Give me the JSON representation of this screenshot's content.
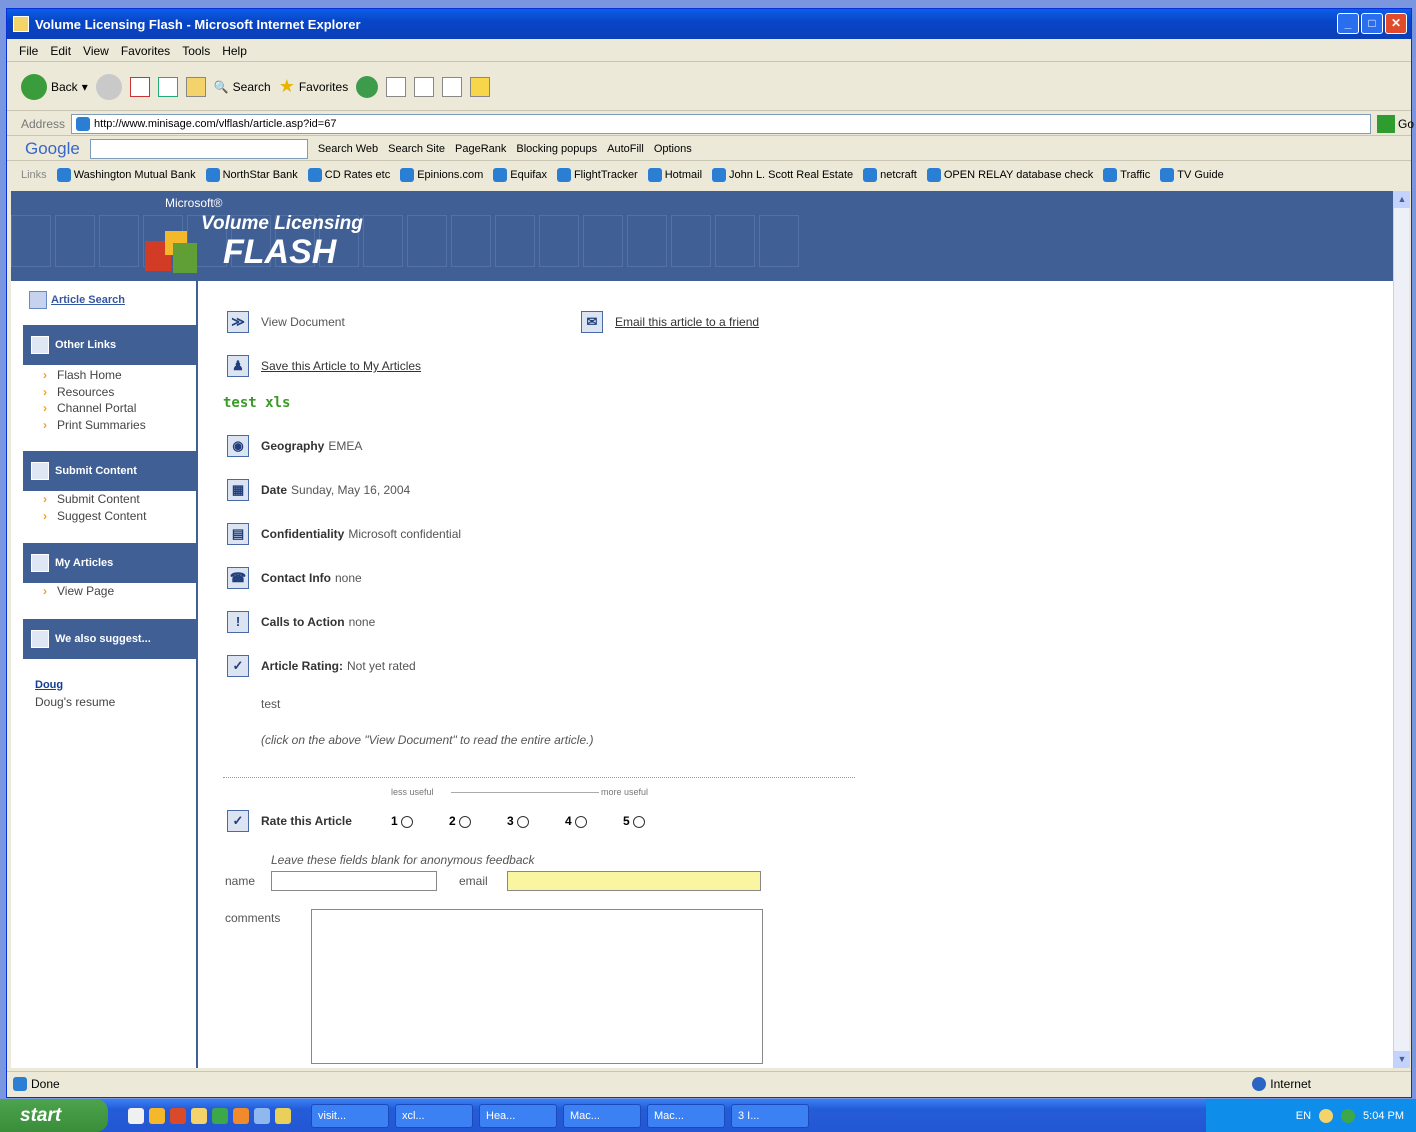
{
  "window": {
    "title": "Volume Licensing Flash - Microsoft Internet Explorer"
  },
  "menu": [
    "File",
    "Edit",
    "View",
    "Favorites",
    "Tools",
    "Help"
  ],
  "toolbar": {
    "back": "Back",
    "search": "Search",
    "favorites": "Favorites"
  },
  "address": {
    "label": "Address",
    "url": "http://www.minisage.com/vlflash/article.asp?id=67",
    "go": "Go"
  },
  "google": {
    "label": "Google",
    "search_web": "Search Web",
    "search_site": "Search Site",
    "pagerank": "PageRank",
    "blocking": "Blocking popups",
    "autofill": "AutoFill",
    "options": "Options"
  },
  "links": {
    "label": "Links",
    "items": [
      "Washington Mutual Bank",
      "NorthStar Bank",
      "CD Rates etc",
      "Epinions.com",
      "Equifax",
      "FlightTracker",
      "Hotmail",
      "John L. Scott Real Estate",
      "netcraft",
      "OPEN RELAY database check",
      "Traffic",
      "TV Guide"
    ]
  },
  "banner": {
    "microsoft": "Microsoft®",
    "vl": "Volume Licensing",
    "flash": "FLASH"
  },
  "sidebar": {
    "search": "Article Search",
    "other_links": "Other Links",
    "other_items": [
      "Flash Home",
      "Resources",
      "Channel Portal",
      "Print Summaries"
    ],
    "submit": "Submit Content",
    "submit_items": [
      "Submit Content",
      "Suggest Content"
    ],
    "my_articles": "My Articles",
    "my_items": [
      "View Page"
    ],
    "suggest": "We also suggest...",
    "doug_name": "Doug",
    "doug_desc": "Doug's resume"
  },
  "article": {
    "view_doc": "View Document",
    "email": "Email this article to a friend",
    "save": "Save this Article to My Articles",
    "title": "test xls",
    "geo_label": "Geography",
    "geo": "EMEA",
    "date_label": "Date",
    "date": "Sunday, May 16, 2004",
    "conf_label": "Confidentiality",
    "conf": "Microsoft confidential",
    "contact_label": "Contact Info",
    "contact": "none",
    "calls_label": "Calls to Action",
    "calls": "none",
    "rating_label": "Article Rating:",
    "rating": "Not yet rated",
    "body": "test",
    "note": "(click on the above \"View Document\" to read the entire article.)"
  },
  "rate": {
    "less": "less useful",
    "more": "more useful",
    "label": "Rate this Article",
    "options": [
      "1",
      "2",
      "3",
      "4",
      "5"
    ],
    "hint": "Leave these fields blank for anonymous feedback",
    "name": "name",
    "email": "email",
    "comments": "comments"
  },
  "status": {
    "left": "Done",
    "zone": "Internet"
  },
  "taskbar": {
    "start": "start",
    "tasks": [
      "visit...",
      "xcl...",
      "Hea...",
      "Mac...",
      "Mac...",
      "3 I..."
    ],
    "lang": "EN",
    "clock": "5:04 PM"
  }
}
